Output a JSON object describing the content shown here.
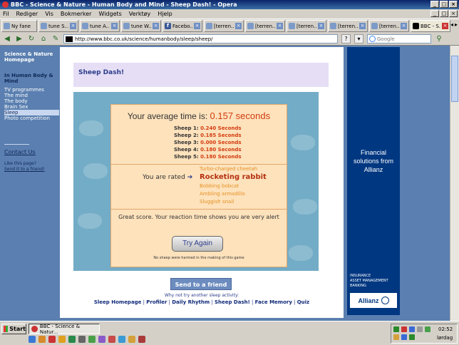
{
  "window": {
    "title": "BBC - Science & Nature - Human Body and Mind - Sheep Dash! - Opera",
    "buttons": [
      "_",
      "□",
      "×"
    ]
  },
  "menu": [
    "Fil",
    "Rediger",
    "Vis",
    "Bokmerker",
    "Widgets",
    "Verktøy",
    "Hjelp"
  ],
  "tabs": [
    {
      "label": "Ny fane",
      "icon": "new-tab-icon"
    },
    {
      "label": "tune S...",
      "icon": "page-icon"
    },
    {
      "label": "tune A...",
      "icon": "page-icon"
    },
    {
      "label": "tune W...",
      "icon": "page-icon"
    },
    {
      "label": "Facebo...",
      "icon": "facebook-icon"
    },
    {
      "label": "[terren...",
      "icon": "gear-icon"
    },
    {
      "label": "[terren...",
      "icon": "gear-icon"
    },
    {
      "label": "[terren...",
      "icon": "gear-icon"
    },
    {
      "label": "[terren...",
      "icon": "gear-icon"
    },
    {
      "label": "[terren...",
      "icon": "gear-icon"
    },
    {
      "label": "BBC - S...",
      "icon": "bbc-icon"
    }
  ],
  "address": {
    "url": "http://www.bbc.co.uk/science/humanbody/sleep/sheep/",
    "search_placeholder": "Google"
  },
  "leftnav": {
    "home": "Science & Nature Homepage",
    "section": "In Human Body & Mind",
    "items": [
      "TV programmes",
      "The mind",
      "The body",
      "Brain Sex",
      "Sleep",
      "Photo competition"
    ],
    "active_index": 4,
    "contact": "Contact Us",
    "like": "Like this page?",
    "send_friend": "Send it to a friend!"
  },
  "page": {
    "title": "Sheep Dash!"
  },
  "result": {
    "avg_label": "Your average time is:",
    "avg_value": "0.157 seconds",
    "sheep": [
      {
        "label": "Sheep 1:",
        "value": "0.240 Seconds"
      },
      {
        "label": "Sheep 2:",
        "value": "0.185 Seconds"
      },
      {
        "label": "Sheep 3:",
        "value": "0.000 Seconds"
      },
      {
        "label": "Sheep 4:",
        "value": "0.180 Seconds"
      },
      {
        "label": "Sheep 5:",
        "value": "0.180 Seconds"
      }
    ],
    "rated_label": "You are rated",
    "ratings": [
      "Turbo-charged cheetah",
      "Rocketing rabbit",
      "Bobbing bobcat",
      "Ambling armadillo",
      "Sluggish snail"
    ],
    "current_rating_index": 1,
    "comment": "Great score. Your reaction time shows you are very alert",
    "try_again": "Try Again",
    "disclaimer": "No sheep were harmed in the making of this game"
  },
  "footer": {
    "send_button": "Send to a friend",
    "why_not": "Why not try another sleep activity:",
    "links": [
      "Sleep Homepage",
      "Profiler",
      "Daily Rhythm",
      "Sheep Dash!",
      "Face Memory",
      "Quiz"
    ]
  },
  "ad": {
    "headline": "Financial solutions from Allianz",
    "small": [
      "INSURANCE",
      "ASSET MANAGEMENT",
      "BANKING"
    ],
    "logo": "Allianz"
  },
  "taskbar": {
    "start": "Start",
    "task": "BBC - Science & Natur...",
    "time": "02:52",
    "day": "lørdag"
  },
  "colors": {
    "accent": "#d33c10",
    "nav_bg": "#5a7fb0",
    "panel_bg": "#fde2bc",
    "ad_bg": "#003781"
  }
}
